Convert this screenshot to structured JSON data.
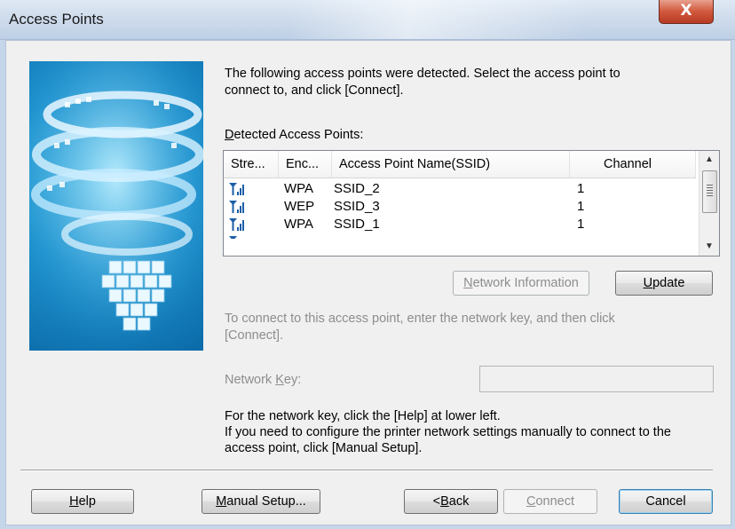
{
  "window": {
    "title": "Access Points",
    "close_label": "X"
  },
  "intro_text_line1": "The following access points were detected. Select the access point to",
  "intro_text_line2": "connect to, and click [Connect].",
  "list_label": {
    "accel": "D",
    "rest": "etected Access Points:"
  },
  "columns": [
    "Stre...",
    "Enc...",
    "Access Point Name(SSID)",
    "Channel"
  ],
  "rows": [
    {
      "strength_icon": "signal-strength-icon",
      "encryption": "WPA",
      "ssid": "SSID_2",
      "channel": "1"
    },
    {
      "strength_icon": "signal-strength-icon",
      "encryption": "WEP",
      "ssid": "SSID_3",
      "channel": "1"
    },
    {
      "strength_icon": "signal-strength-icon",
      "encryption": "WPA",
      "ssid": "SSID_1",
      "channel": "1"
    }
  ],
  "buttons": {
    "network_info": {
      "accel": "N",
      "rest": "etwork Information"
    },
    "update": {
      "accel": "U",
      "rest": "pdate"
    },
    "help": {
      "accel": "H",
      "rest": "elp"
    },
    "manual_setup": {
      "accel": "M",
      "rest": "anual Setup..."
    },
    "back": {
      "pre": "<",
      "accel": "B",
      "rest": "ack"
    },
    "connect": {
      "accel": "C",
      "rest": "onnect"
    },
    "cancel": "Cancel"
  },
  "connect_hint_line1": "To connect to this access point, enter the network key, and then click",
  "connect_hint_line2": "[Connect].",
  "network_key_label": {
    "pre": "Network ",
    "accel": "K",
    "rest": "ey:"
  },
  "network_key_value": "",
  "help_text_line1": "For the network key, click the [Help] at lower left.",
  "help_text_line2": "If you need to configure the printer network settings manually to connect to the",
  "help_text_line3": "access point, click [Manual Setup].",
  "colors": {
    "accent": "#1f93cf",
    "close_button": "#c8452d",
    "signal_icon": "#1b5ea8"
  }
}
